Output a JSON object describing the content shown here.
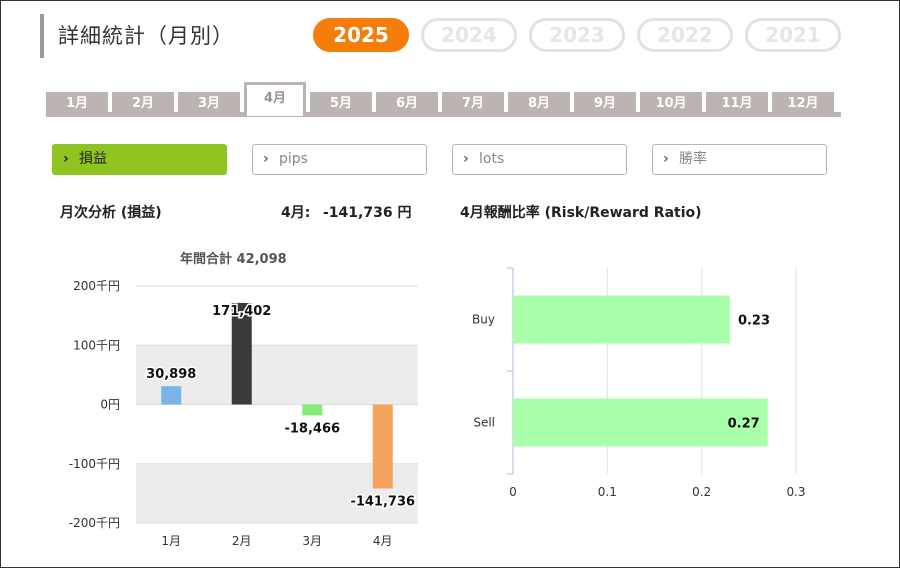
{
  "title": "詳細統計（月別）",
  "years": [
    {
      "label": "2025",
      "active": true
    },
    {
      "label": "2024",
      "active": false
    },
    {
      "label": "2023",
      "active": false
    },
    {
      "label": "2022",
      "active": false
    },
    {
      "label": "2021",
      "active": false
    }
  ],
  "months": [
    {
      "label": "1月",
      "active": false
    },
    {
      "label": "2月",
      "active": false
    },
    {
      "label": "3月",
      "active": false
    },
    {
      "label": "4月",
      "active": true
    },
    {
      "label": "5月",
      "active": false
    },
    {
      "label": "6月",
      "active": false
    },
    {
      "label": "7月",
      "active": false
    },
    {
      "label": "8月",
      "active": false
    },
    {
      "label": "9月",
      "active": false
    },
    {
      "label": "10月",
      "active": false
    },
    {
      "label": "11月",
      "active": false
    },
    {
      "label": "12月",
      "active": false
    }
  ],
  "selectors": [
    {
      "label": "損益",
      "active": true
    },
    {
      "label": "pips",
      "active": false
    },
    {
      "label": "lots",
      "active": false
    },
    {
      "label": "勝率",
      "active": false
    }
  ],
  "monthly": {
    "heading": "月次分析 (損益)",
    "current_label": "4月:",
    "current_value": "-141,736 円",
    "annual_total": "年間合計 42,098"
  },
  "ratio": {
    "heading": "4月報酬比率 (Risk/Reward Ratio)"
  },
  "colors": {
    "accent": "#f57e0b",
    "active_selector": "#8fc31f",
    "tab": "#bcb4b1"
  },
  "chart_data": [
    {
      "type": "bar",
      "categories": [
        "1月",
        "2月",
        "3月",
        "4月"
      ],
      "values": [
        30898,
        171402,
        -18466,
        -141736
      ],
      "value_labels": [
        "30,898",
        "171,402",
        "-18,466",
        "-141,736"
      ],
      "bar_colors": [
        "#7ab4e8",
        "#3a3a3c",
        "#85ea79",
        "#f4a45c"
      ],
      "yticks": [
        200000,
        100000,
        0,
        -100000,
        -200000
      ],
      "ytick_labels": [
        "200千円",
        "100千円",
        "0円",
        "-100千円",
        "-200千円"
      ],
      "ylim": [
        -200000,
        200000
      ]
    },
    {
      "type": "bar",
      "orientation": "horizontal",
      "categories": [
        "Buy",
        "Sell"
      ],
      "values": [
        0.23,
        0.27
      ],
      "value_labels": [
        "0.23",
        "0.27"
      ],
      "bar_color": "#aaffaa",
      "xticks": [
        0,
        0.1,
        0.2,
        0.3
      ],
      "xtick_labels": [
        "0",
        "0.1",
        "0.2",
        "0.3"
      ],
      "xlim": [
        0,
        0.3
      ]
    }
  ]
}
